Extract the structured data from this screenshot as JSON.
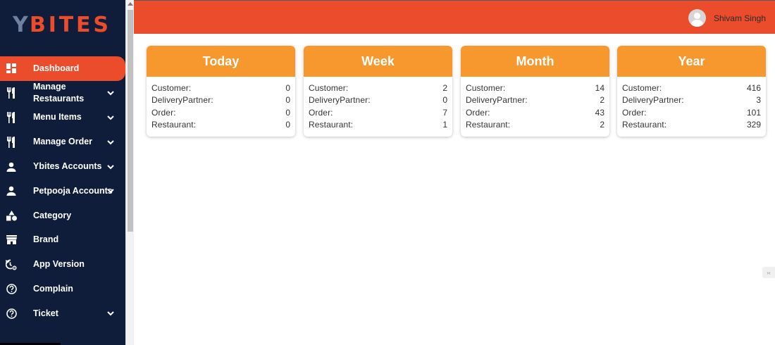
{
  "brand": {
    "logo_text": "YBITES",
    "logo_color": "#ea4c2c",
    "logo_accent": "#6f7f9c"
  },
  "colors": {
    "sidebar_bg": "#0f1c3a",
    "header_bg": "#ea4c2c",
    "card_header": "#f7982e",
    "active_item": "#ea4c2c"
  },
  "header": {
    "user_name": "Shivam Singh"
  },
  "sidebar": {
    "items": [
      {
        "label": "Dashboard",
        "icon": "dashboard-grid-icon",
        "expandable": false,
        "active": true
      },
      {
        "label": "Manage Restaurants",
        "icon": "fork-knife-icon",
        "expandable": true,
        "active": false
      },
      {
        "label": "Menu Items",
        "icon": "fork-knife-icon",
        "expandable": true,
        "active": false
      },
      {
        "label": "Manage Order",
        "icon": "fork-knife-icon",
        "expandable": true,
        "active": false
      },
      {
        "label": "Ybites Accounts",
        "icon": "person-icon",
        "expandable": true,
        "active": false
      },
      {
        "label": "Petpooja Accounts",
        "icon": "person-icon",
        "expandable": true,
        "active": false
      },
      {
        "label": "Category",
        "icon": "shapes-icon",
        "expandable": false,
        "active": false
      },
      {
        "label": "Brand",
        "icon": "store-icon",
        "expandable": false,
        "active": false
      },
      {
        "label": "App Version",
        "icon": "settings-history-icon",
        "expandable": false,
        "active": false
      },
      {
        "label": "Complain",
        "icon": "help-circle-icon",
        "expandable": false,
        "active": false
      },
      {
        "label": "Ticket",
        "icon": "help-circle-icon",
        "expandable": true,
        "active": false
      }
    ]
  },
  "cards": [
    {
      "title": "Today",
      "rows": [
        {
          "label": "Customer:",
          "value": "0"
        },
        {
          "label": "DeliveryPartner:",
          "value": "0"
        },
        {
          "label": "Order:",
          "value": "0"
        },
        {
          "label": "Restaurant:",
          "value": "0"
        }
      ]
    },
    {
      "title": "Week",
      "rows": [
        {
          "label": "Customer:",
          "value": "2"
        },
        {
          "label": "DeliveryPartner:",
          "value": "0"
        },
        {
          "label": "Order:",
          "value": "7"
        },
        {
          "label": "Restaurant:",
          "value": "1"
        }
      ]
    },
    {
      "title": "Month",
      "rows": [
        {
          "label": "Customer:",
          "value": "14"
        },
        {
          "label": "DeliveryPartner:",
          "value": "2"
        },
        {
          "label": "Order:",
          "value": "43"
        },
        {
          "label": "Restaurant:",
          "value": "2"
        }
      ]
    },
    {
      "title": "Year",
      "rows": [
        {
          "label": "Customer:",
          "value": "416"
        },
        {
          "label": "DeliveryPartner:",
          "value": "3"
        },
        {
          "label": "Order:",
          "value": "101"
        },
        {
          "label": "Restaurant:",
          "value": "329"
        }
      ]
    }
  ]
}
